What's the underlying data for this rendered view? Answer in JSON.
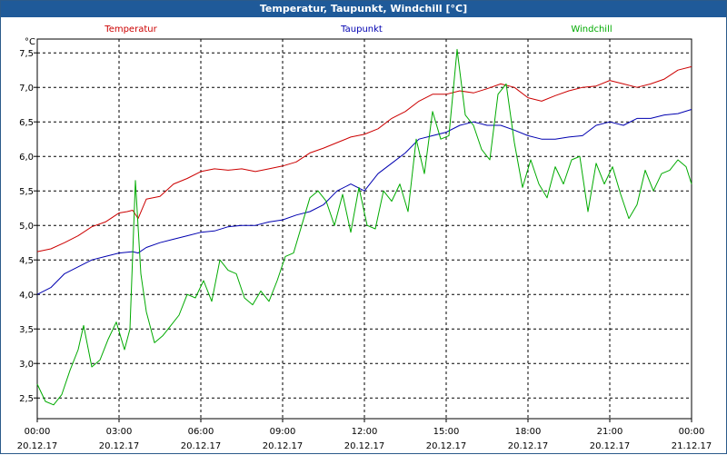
{
  "title": "Temperatur, Taupunkt, Windchill [°C]",
  "chart_data": {
    "type": "line",
    "title": "Temperatur, Taupunkt, Windchill [°C]",
    "ylabel": "°C",
    "xlabel": "",
    "ylim": [
      2.2,
      7.7
    ],
    "y_ticks": [
      "2,5",
      "3,0",
      "3,5",
      "4,0",
      "4,5",
      "5,0",
      "5,5",
      "6,0",
      "6,5",
      "7,0",
      "7,5"
    ],
    "x_range_hours": [
      0,
      24
    ],
    "x_ticks": [
      {
        "time": "00:00",
        "date": "20.12.17"
      },
      {
        "time": "03:00",
        "date": "20.12.17"
      },
      {
        "time": "06:00",
        "date": "20.12.17"
      },
      {
        "time": "09:00",
        "date": "20.12.17"
      },
      {
        "time": "12:00",
        "date": "20.12.17"
      },
      {
        "time": "15:00",
        "date": "20.12.17"
      },
      {
        "time": "18:00",
        "date": "20.12.17"
      },
      {
        "time": "21:00",
        "date": "20.12.17"
      },
      {
        "time": "00:00",
        "date": "21.12.17"
      }
    ],
    "grid": true,
    "legend_placement": "top",
    "series": [
      {
        "name": "Temperatur",
        "color": "#cc0000",
        "x_hours": [
          0,
          0.5,
          1,
          1.5,
          2,
          2.5,
          3,
          3.3,
          3.5,
          3.7,
          4,
          4.5,
          5,
          5.5,
          6,
          6.5,
          7,
          7.5,
          8,
          8.5,
          9,
          9.5,
          10,
          10.5,
          11,
          11.5,
          12,
          12.5,
          13,
          13.5,
          14,
          14.5,
          15,
          15.5,
          16,
          16.5,
          17,
          17.5,
          18,
          18.5,
          19,
          19.5,
          20,
          20.5,
          21,
          21.5,
          22,
          22.5,
          23,
          23.5,
          24
        ],
        "values": [
          4.62,
          4.66,
          4.75,
          4.85,
          4.98,
          5.05,
          5.18,
          5.2,
          5.22,
          5.1,
          5.38,
          5.42,
          5.6,
          5.68,
          5.78,
          5.82,
          5.8,
          5.82,
          5.78,
          5.82,
          5.86,
          5.92,
          6.05,
          6.12,
          6.2,
          6.28,
          6.32,
          6.4,
          6.55,
          6.65,
          6.8,
          6.9,
          6.9,
          6.95,
          6.92,
          6.98,
          7.05,
          7.0,
          6.85,
          6.8,
          6.88,
          6.95,
          7.0,
          7.02,
          7.1,
          7.05,
          7.0,
          7.05,
          7.12,
          7.25,
          7.3
        ]
      },
      {
        "name": "Taupunkt",
        "color": "#0000b0",
        "x_hours": [
          0,
          0.5,
          1,
          1.5,
          2,
          2.5,
          3,
          3.5,
          3.7,
          4,
          4.5,
          5,
          5.5,
          6,
          6.5,
          7,
          7.5,
          8,
          8.5,
          9,
          9.5,
          10,
          10.5,
          11,
          11.5,
          12,
          12.5,
          13,
          13.5,
          14,
          14.5,
          15,
          15.5,
          16,
          16.5,
          17,
          17.5,
          18,
          18.5,
          19,
          19.5,
          20,
          20.5,
          21,
          21.5,
          22,
          22.5,
          23,
          23.5,
          24
        ],
        "values": [
          4.0,
          4.1,
          4.3,
          4.4,
          4.5,
          4.55,
          4.6,
          4.62,
          4.6,
          4.68,
          4.75,
          4.8,
          4.85,
          4.9,
          4.92,
          4.98,
          5.0,
          5.0,
          5.05,
          5.08,
          5.15,
          5.2,
          5.3,
          5.5,
          5.6,
          5.5,
          5.75,
          5.9,
          6.05,
          6.25,
          6.3,
          6.35,
          6.45,
          6.5,
          6.45,
          6.45,
          6.38,
          6.3,
          6.25,
          6.25,
          6.28,
          6.3,
          6.45,
          6.5,
          6.45,
          6.55,
          6.55,
          6.6,
          6.62,
          6.68,
          6.72
        ]
      },
      {
        "name": "Windchill",
        "color": "#00aa00",
        "x_hours": [
          0,
          0.3,
          0.6,
          0.9,
          1.2,
          1.5,
          1.7,
          2,
          2.3,
          2.6,
          2.9,
          3.2,
          3.4,
          3.6,
          3.8,
          4,
          4.3,
          4.6,
          4.9,
          5.2,
          5.5,
          5.8,
          6.1,
          6.4,
          6.7,
          7,
          7.3,
          7.6,
          7.9,
          8.2,
          8.5,
          8.8,
          9.1,
          9.4,
          9.7,
          10,
          10.3,
          10.6,
          10.9,
          11.2,
          11.5,
          11.8,
          12.1,
          12.4,
          12.7,
          13,
          13.3,
          13.6,
          13.9,
          14.2,
          14.5,
          14.8,
          15.1,
          15.4,
          15.7,
          16,
          16.3,
          16.6,
          16.9,
          17.2,
          17.5,
          17.8,
          18.1,
          18.4,
          18.7,
          19,
          19.3,
          19.6,
          19.9,
          20.2,
          20.5,
          20.8,
          21.1,
          21.4,
          21.7,
          22,
          22.3,
          22.6,
          22.9,
          23.2,
          23.5,
          23.8,
          24
        ],
        "values": [
          2.7,
          2.45,
          2.4,
          2.55,
          2.9,
          3.2,
          3.55,
          2.95,
          3.05,
          3.35,
          3.6,
          3.2,
          3.5,
          5.65,
          4.3,
          3.75,
          3.3,
          3.4,
          3.55,
          3.7,
          4.0,
          3.95,
          4.2,
          3.9,
          4.5,
          4.35,
          4.3,
          3.95,
          3.85,
          4.05,
          3.9,
          4.2,
          4.55,
          4.6,
          5.0,
          5.4,
          5.5,
          5.35,
          5.0,
          5.45,
          4.9,
          5.55,
          5.0,
          4.95,
          5.5,
          5.35,
          5.6,
          5.2,
          6.25,
          5.75,
          6.65,
          6.25,
          6.3,
          7.55,
          6.6,
          6.45,
          6.1,
          5.95,
          6.9,
          7.05,
          6.2,
          5.55,
          5.95,
          5.6,
          5.4,
          5.85,
          5.6,
          5.95,
          6.0,
          5.2,
          5.9,
          5.6,
          5.85,
          5.45,
          5.1,
          5.3,
          5.8,
          5.5,
          5.75,
          5.8,
          5.95,
          5.85,
          5.6
        ]
      }
    ]
  }
}
